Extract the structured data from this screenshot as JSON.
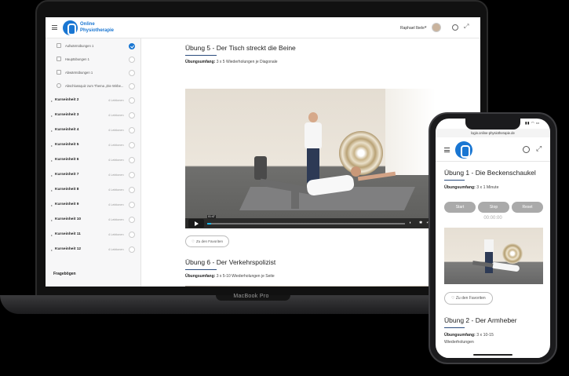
{
  "laptop": {
    "brand": "MacBook Pro",
    "header": {
      "logo_line1": "Online",
      "logo_line2": "Physiotherapie",
      "user_name": "Raphael Ibele"
    },
    "sidebar": {
      "subitems": [
        {
          "label": "Aufwärmübungen 1",
          "done": true
        },
        {
          "label": "Hauptübungen 1",
          "done": false
        },
        {
          "label": "Abwärmübungen 1",
          "done": false
        },
        {
          "label": "Abschlussquiz zum Thema „Die Wirbe...",
          "done": false
        }
      ],
      "units": [
        {
          "label": "Kurseinheit 2",
          "count": "4 Lektionen"
        },
        {
          "label": "Kurseinheit 3",
          "count": "4 Lektionen"
        },
        {
          "label": "Kurseinheit 4",
          "count": "4 Lektionen"
        },
        {
          "label": "Kurseinheit 5",
          "count": "4 Lektionen"
        },
        {
          "label": "Kurseinheit 6",
          "count": "4 Lektionen"
        },
        {
          "label": "Kurseinheit 7",
          "count": "4 Lektionen"
        },
        {
          "label": "Kurseinheit 8",
          "count": "4 Lektionen"
        },
        {
          "label": "Kurseinheit 9",
          "count": "4 Lektionen"
        },
        {
          "label": "Kurseinheit 10",
          "count": "4 Lektionen"
        },
        {
          "label": "Kurseinheit 11",
          "count": "4 Lektionen"
        },
        {
          "label": "Kurseinheit 12",
          "count": "4 Lektionen"
        }
      ],
      "section_title": "Fragebögen"
    },
    "main": {
      "exercise5": {
        "title": "Übung 5 - Der Tisch streckt die Beine",
        "scope_label": "Übungsumfang:",
        "scope_value": "3 x 5 Wiederholungen je Diagonale"
      },
      "video": {
        "time": "01:47",
        "progress": 0.02
      },
      "favorite_label": "Zu den Favoriten",
      "exercise6": {
        "title": "Übung 6 - Der Verkehrspolizist",
        "scope_label": "Übungsumfang:",
        "scope_value": "3 x 5-10 Wiederholungen je Seite"
      }
    }
  },
  "phone": {
    "status_time": "",
    "url": "login.online-physiotherapie.de",
    "exercise1": {
      "title": "Übung 1 - Die Beckenschaukel",
      "scope_label": "Übungsumfang:",
      "scope_value": "3 x 1 Minute"
    },
    "buttons": {
      "start": "Start",
      "stop": "Stop",
      "reset": "Reset"
    },
    "timer": "00:00:00",
    "favorite_label": "Zu den Favoriten",
    "exercise2": {
      "title": "Übung 2 - Der Armheber",
      "scope_label": "Übungsumfang:",
      "scope_value": "3 x 10-15",
      "scope_value2": "Wiederholungen"
    }
  },
  "colors": {
    "brand": "#1976d2",
    "accent_line": "#2b4c7e",
    "video_progress": "#1ab7ea",
    "button_grey": "#aaaaaa"
  }
}
